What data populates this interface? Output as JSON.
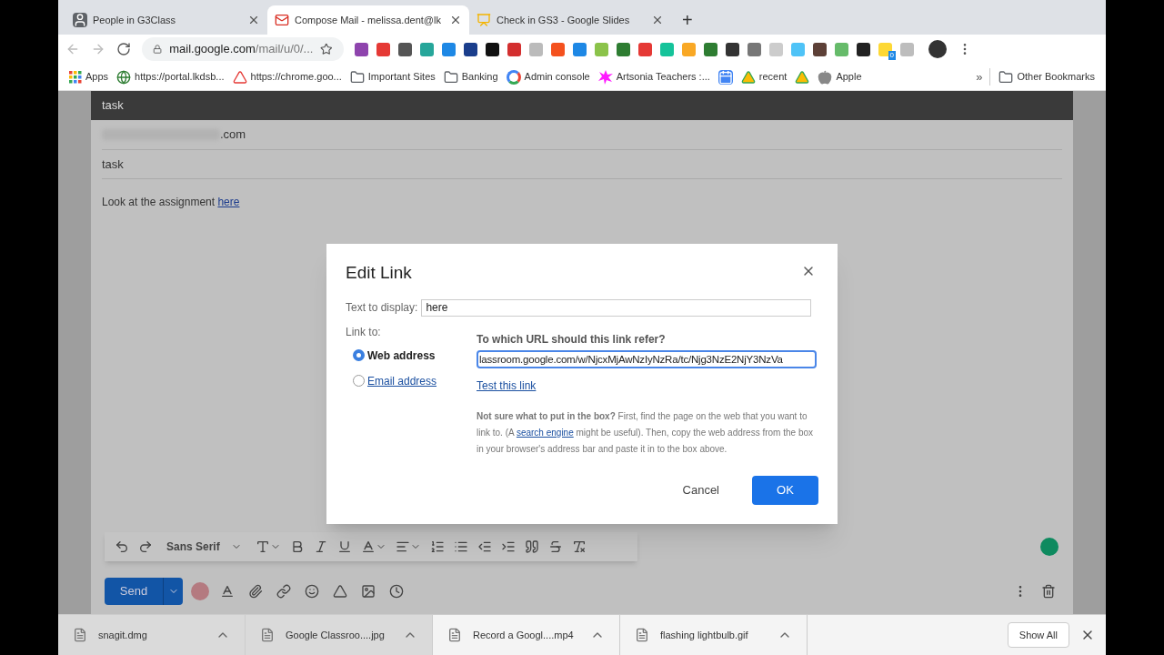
{
  "tabs": [
    {
      "title": "People in G3Class",
      "kind": "contacts",
      "selected": false
    },
    {
      "title": "Compose Mail - melissa.dent@lk",
      "kind": "gmail",
      "selected": true
    },
    {
      "title": "Check in GS3 - Google Slides",
      "kind": "slides",
      "selected": false
    }
  ],
  "new_tab": "+",
  "address_bar": {
    "host": "mail.google.com",
    "path": "/mail/u/0/..."
  },
  "extension_badge": "0",
  "bookmarks": [
    {
      "label": "Apps",
      "kind": "apps"
    },
    {
      "label": "https://portal.lkdsb...",
      "kind": "site"
    },
    {
      "label": "https://chrome.goo...",
      "kind": "rainbow"
    },
    {
      "label": "Important Sites",
      "kind": "folder"
    },
    {
      "label": "Banking",
      "kind": "folder"
    },
    {
      "label": "Admin console",
      "kind": "google"
    },
    {
      "label": "Artsonia Teachers :...",
      "kind": "splat"
    },
    {
      "kind": "calendar"
    },
    {
      "label": "recent",
      "kind": "drive"
    },
    {
      "kind": "drive"
    },
    {
      "label": "Apple",
      "kind": "apple"
    }
  ],
  "bookmarks_overflow": "»",
  "other_bookmarks": "Other Bookmarks",
  "compose": {
    "title": "task",
    "recipient": ".com",
    "subject": "task",
    "body": "Look at the assignment ",
    "body_link": "here"
  },
  "format_toolbar": {
    "font": "Sans Serif"
  },
  "send": "Send",
  "dialog": {
    "title": "Edit Link",
    "text_label": "Text to display:",
    "text_value": "here",
    "link_to_label": "Link to:",
    "options": [
      {
        "label": "Web address",
        "selected": true
      },
      {
        "label": "Email address",
        "selected": false
      }
    ],
    "url_label": "To which URL should this link refer?",
    "url_value": "lassroom.google.com/w/NjcxMjAwNzIyNzRa/tc/Njg3NzE2NjY3NzVa",
    "test_link": "Test this link",
    "help_start": "**Not sure what to put in the box?** First, find the page on the web that you want to link to. (A ",
    "help_link": "search engine",
    "help_end": " might be useful). Then, copy the web address from the box in your browser's address bar and paste it in to the box above.",
    "cancel": "Cancel",
    "ok": "OK"
  },
  "downloads": [
    {
      "name": "snagit.dmg"
    },
    {
      "name": "Google Classroo....jpg"
    },
    {
      "name": "Record a Googl....mp4"
    },
    {
      "name": "flashing lightbulb.gif"
    }
  ],
  "show_all": "Show All"
}
